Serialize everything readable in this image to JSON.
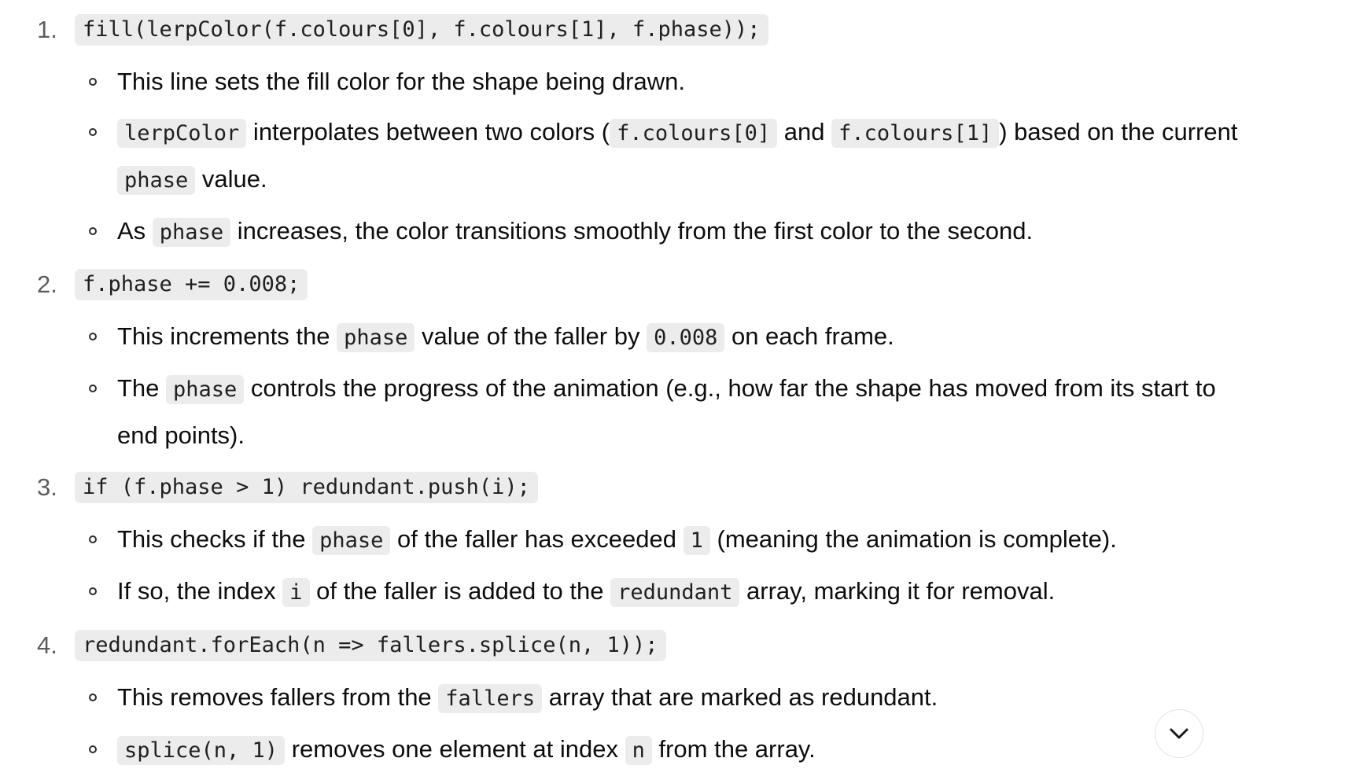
{
  "steps": [
    {
      "number": "1.",
      "code": "fill(lerpColor(f.colours[0], f.colours[1], f.phase));",
      "bullets": [
        [
          "This line sets the fill color for the shape being drawn."
        ],
        [
          {
            "code": "lerpColor"
          },
          " interpolates between two colors (",
          {
            "code": "f.colours[0]"
          },
          " and ",
          {
            "code": "f.colours[1]"
          },
          ") based on the current ",
          {
            "code": "phase"
          },
          " value."
        ],
        [
          "As ",
          {
            "code": "phase"
          },
          " increases, the color transitions smoothly from the first color to the second."
        ]
      ]
    },
    {
      "number": "2.",
      "code": "f.phase += 0.008;",
      "bullets": [
        [
          "This increments the ",
          {
            "code": "phase"
          },
          " value of the faller by ",
          {
            "code": "0.008"
          },
          " on each frame."
        ],
        [
          "The ",
          {
            "code": "phase"
          },
          " controls the progress of the animation (e.g., how far the shape has moved from its start to end points)."
        ]
      ]
    },
    {
      "number": "3.",
      "code": "if (f.phase > 1) redundant.push(i);",
      "bullets": [
        [
          "This checks if the ",
          {
            "code": "phase"
          },
          " of the faller has exceeded ",
          {
            "code": "1"
          },
          " (meaning the animation is complete)."
        ],
        [
          "If so, the index ",
          {
            "code": "i"
          },
          " of the faller is added to the ",
          {
            "code": "redundant"
          },
          " array, marking it for removal."
        ]
      ]
    },
    {
      "number": "4.",
      "code": "redundant.forEach(n => fallers.splice(n, 1));",
      "bullets": [
        [
          "This removes fallers from the ",
          {
            "code": "fallers"
          },
          " array that are marked as redundant."
        ],
        [
          {
            "code": "splice(n, 1)"
          },
          " removes one element at index ",
          {
            "code": "n"
          },
          " from the array."
        ]
      ]
    }
  ],
  "scroll_button": {
    "icon": "chevron-down-icon"
  }
}
